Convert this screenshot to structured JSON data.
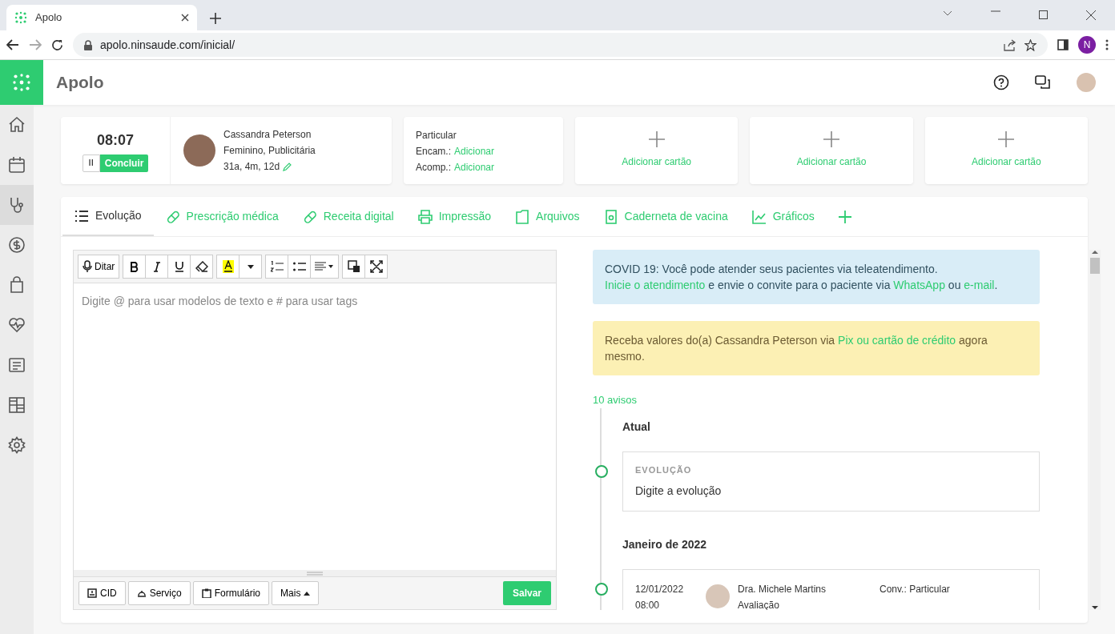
{
  "browser": {
    "tab_title": "Apolo",
    "url": "apolo.ninsaude.com/inicial/",
    "profile_initial": "N"
  },
  "app": {
    "title": "Apolo"
  },
  "sidebar": {
    "items": [
      {
        "selected": false
      },
      {
        "selected": false
      },
      {
        "selected": true
      },
      {
        "selected": false
      },
      {
        "selected": false
      },
      {
        "selected": false
      },
      {
        "selected": false
      },
      {
        "selected": false
      },
      {
        "selected": false
      }
    ]
  },
  "timer": {
    "time": "08:07",
    "pause_label": "II",
    "finish_label": "Concluir"
  },
  "patient": {
    "name": "Cassandra Peterson",
    "details": "Feminino, Publicitária",
    "age": "31a, 4m, 12d"
  },
  "insurance": {
    "plan": "Particular",
    "rows": [
      {
        "label": "Encam.:",
        "action": "Adicionar"
      },
      {
        "label": "Acomp.:",
        "action": "Adicionar"
      }
    ]
  },
  "add_cards": [
    {
      "label": "Adicionar cartão"
    },
    {
      "label": "Adicionar cartão"
    },
    {
      "label": "Adicionar cartão"
    }
  ],
  "tabs": [
    {
      "label": "Evolução",
      "selected": true
    },
    {
      "label": "Prescrição médica",
      "selected": false
    },
    {
      "label": "Receita digital",
      "selected": false
    },
    {
      "label": "Impressão",
      "selected": false
    },
    {
      "label": "Arquivos",
      "selected": false
    },
    {
      "label": "Caderneta de vacina",
      "selected": false
    },
    {
      "label": "Gráficos",
      "selected": false
    }
  ],
  "editor": {
    "dictate_label": "Ditar",
    "placeholder": "Digite @ para usar modelos de texto e # para usar tags",
    "footer_buttons": [
      {
        "label": "CID"
      },
      {
        "label": "Serviço"
      },
      {
        "label": "Formulário"
      },
      {
        "label": "Mais"
      }
    ],
    "save_label": "Salvar"
  },
  "alerts": [
    {
      "kind": "info",
      "parts": [
        {
          "kind": "text",
          "text": "COVID 19: Você pode atender seus pacientes via teleatendimento. "
        },
        {
          "kind": "link",
          "text": "Inicie o atendimento"
        },
        {
          "kind": "text",
          "text": " e envie o convite para o paciente via "
        },
        {
          "kind": "link",
          "text": "WhatsApp"
        },
        {
          "kind": "text",
          "text": " ou "
        },
        {
          "kind": "link",
          "text": "e-mail"
        },
        {
          "kind": "text",
          "text": "."
        }
      ]
    },
    {
      "kind": "warning",
      "parts": [
        {
          "kind": "text",
          "text": "Receba valores do(a) Cassandra Peterson via "
        },
        {
          "kind": "link",
          "text": "Pix ou cartão de crédito"
        },
        {
          "kind": "text",
          "text": " agora mesmo."
        }
      ]
    }
  ],
  "timeline": {
    "count": "10 avisos",
    "groups": [
      {
        "title": "Atual",
        "entries": [
          {
            "kind": "note",
            "label": "EVOLUÇÃO",
            "text": "Digite a evolução"
          }
        ]
      },
      {
        "title": "Janeiro de 2022",
        "entries": [
          {
            "kind": "visit",
            "date": "12/01/2022",
            "time": "08:00",
            "doctor": "Dra. Michele Martins",
            "type": "Avaliação",
            "insurance": "Conv.: Particular"
          }
        ]
      }
    ]
  }
}
